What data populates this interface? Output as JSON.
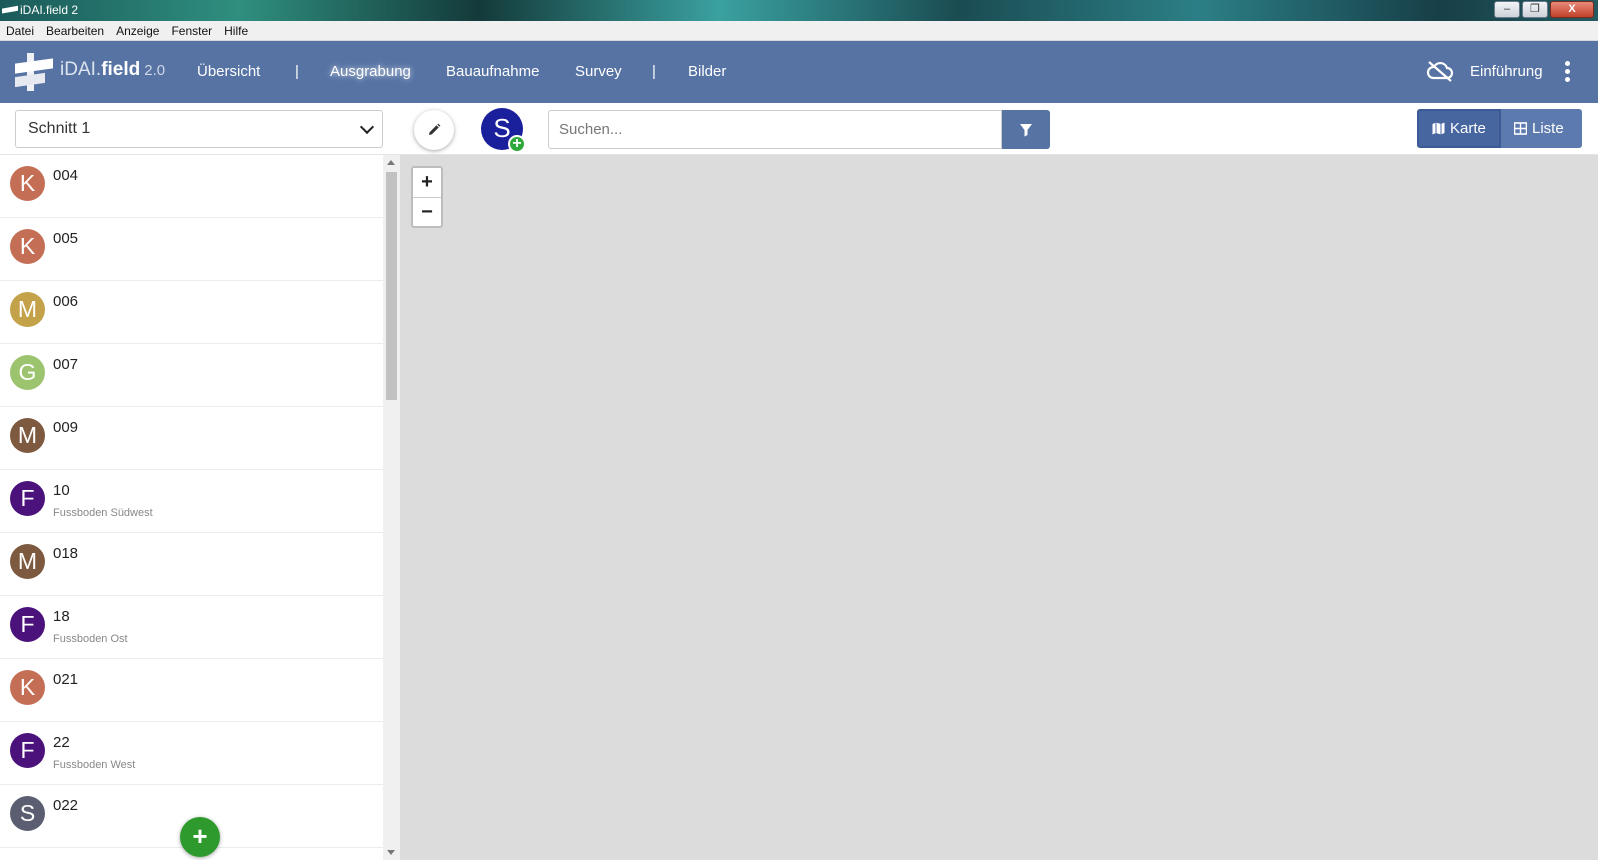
{
  "window": {
    "title": "iDAI.field 2",
    "minimize": "–",
    "maximize": "❐",
    "close": "X"
  },
  "menu": [
    "Datei",
    "Bearbeiten",
    "Anzeige",
    "Fenster",
    "Hilfe"
  ],
  "navbar": {
    "brand_light": "iDAI.",
    "brand_bold": "field",
    "version": "2.0",
    "items": [
      "Übersicht",
      "Ausgrabung",
      "Bauaufnahme",
      "Survey",
      "Bilder"
    ],
    "separators": [
      "|",
      "|"
    ],
    "active": "Ausgrabung",
    "intro": "Einführung"
  },
  "toolbar": {
    "operation_select": "Schnitt 1",
    "new_operation_letter": "S",
    "new_operation_plus": "+",
    "search_placeholder": "Suchen...",
    "karte": "Karte",
    "liste": "Liste"
  },
  "resources": [
    {
      "letter": "K",
      "id": "004",
      "sub": "",
      "color": "#c46f55"
    },
    {
      "letter": "K",
      "id": "005",
      "sub": "",
      "color": "#c46f55"
    },
    {
      "letter": "M",
      "id": "006",
      "sub": "",
      "color": "#c4a24a"
    },
    {
      "letter": "G",
      "id": "007",
      "sub": "",
      "color": "#9cc46e"
    },
    {
      "letter": "M",
      "id": "009",
      "sub": "",
      "color": "#7d5a3f"
    },
    {
      "letter": "F",
      "id": "10",
      "sub": "Fussboden Südwest",
      "color": "#4a127a"
    },
    {
      "letter": "M",
      "id": "018",
      "sub": "",
      "color": "#7d5a3f"
    },
    {
      "letter": "F",
      "id": "18",
      "sub": "Fussboden Ost",
      "color": "#4a127a"
    },
    {
      "letter": "K",
      "id": "021",
      "sub": "",
      "color": "#c46f55"
    },
    {
      "letter": "F",
      "id": "22",
      "sub": "Fussboden West",
      "color": "#4a127a"
    },
    {
      "letter": "S",
      "id": "022",
      "sub": "",
      "color": "#5a5e70"
    }
  ],
  "add_button": "+",
  "map": {
    "zoom_in": "+",
    "zoom_out": "−"
  }
}
